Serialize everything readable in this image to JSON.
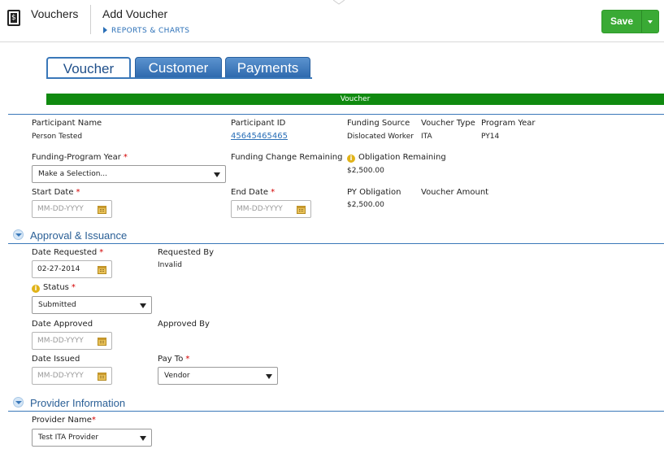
{
  "header": {
    "app_title": "Vouchers",
    "page_title": "Add Voucher",
    "reports_link": "REPORTS & CHARTS",
    "save_label": "Save",
    "icon": "document-dollar-icon"
  },
  "tabs": [
    {
      "label": "Voucher",
      "active": true
    },
    {
      "label": "Customer",
      "active": false
    },
    {
      "label": "Payments",
      "active": false
    }
  ],
  "section_bar": "Voucher",
  "summary": {
    "participant_name_label": "Participant Name",
    "participant_name": "Person Tested",
    "participant_id_label": "Participant ID",
    "participant_id": "45645465465",
    "funding_source_label": "Funding Source",
    "funding_source": "Dislocated Worker",
    "voucher_type_label": "Voucher Type",
    "voucher_type": "ITA",
    "program_year_label": "Program Year",
    "program_year": "PY14"
  },
  "funding": {
    "funding_program_year_label": "Funding-Program Year",
    "funding_program_year_value": "Make a Selection...",
    "funding_change_label": "Funding Change Remaining",
    "obligation_remaining_label": "Obligation Remaining",
    "obligation_remaining": "$2,500.00",
    "start_date_label": "Start Date",
    "start_date_placeholder": "MM-DD-YYYY",
    "end_date_label": "End Date",
    "end_date_placeholder": "MM-DD-YYYY",
    "py_obligation_label": "PY Obligation",
    "py_obligation": "$2,500.00",
    "voucher_amount_label": "Voucher Amount"
  },
  "approval": {
    "title": "Approval & Issuance",
    "date_requested_label": "Date Requested",
    "date_requested": "02-27-2014",
    "requested_by_label": "Requested By",
    "requested_by": "Invalid",
    "status_label": "Status",
    "status_value": "Submitted",
    "date_approved_label": "Date Approved",
    "date_approved_placeholder": "MM-DD-YYYY",
    "approved_by_label": "Approved By",
    "date_issued_label": "Date Issued",
    "date_issued_placeholder": "MM-DD-YYYY",
    "pay_to_label": "Pay To",
    "pay_to_value": "Vendor"
  },
  "provider": {
    "title": "Provider Information",
    "provider_name_label": "Provider Name",
    "provider_name_value": "Test ITA Provider"
  },
  "required_marker": "*",
  "colors": {
    "save_green": "#3aaa35",
    "section_bar_green": "#108a10",
    "tab_blue": "#3a78b9",
    "link_blue": "#2a6fb7",
    "required_red": "#d40000",
    "info_yellow": "#e1b318"
  }
}
